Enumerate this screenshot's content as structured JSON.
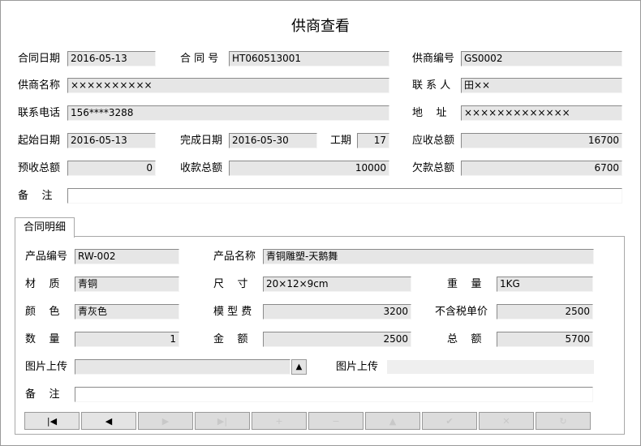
{
  "window": {
    "title": "供商查看"
  },
  "header_form": {
    "contract_date": {
      "label": "合同日期",
      "value": "2016-05-13"
    },
    "contract_no": {
      "label": "合 同 号",
      "value": "HT060513001"
    },
    "supplier_no": {
      "label": "供商编号",
      "value": "GS0002"
    },
    "supplier_name": {
      "label": "供商名称",
      "value": "××××××××××"
    },
    "contact": {
      "label": "联 系 人",
      "value": "田××"
    },
    "phone": {
      "label": "联系电话",
      "value": "156****3288"
    },
    "address": {
      "label": "地    址",
      "value": "×××××××××××××"
    },
    "start_date": {
      "label": "起始日期",
      "value": "2016-05-13"
    },
    "end_date": {
      "label": "完成日期",
      "value": "2016-05-30"
    },
    "duration": {
      "label": "工期",
      "value": "17"
    },
    "receivable_total": {
      "label": "应收总额",
      "value": "16700"
    },
    "prepaid_total": {
      "label": "预收总额",
      "value": "0"
    },
    "received_total": {
      "label": "收款总额",
      "value": "10000"
    },
    "owed_total": {
      "label": "欠款总额",
      "value": "6700"
    },
    "remark": {
      "label": "备    注",
      "value": ""
    }
  },
  "detail_tab": {
    "label": "合同明细",
    "product_no": {
      "label": "产品编号",
      "value": "RW-002"
    },
    "product_name": {
      "label": "产品名称",
      "value": "青铜雕塑-天鹅舞"
    },
    "material": {
      "label": "材    质",
      "value": "青铜"
    },
    "size": {
      "label": "尺    寸",
      "value": "20×12×9cm"
    },
    "weight": {
      "label": "重    量",
      "value": "1KG"
    },
    "color": {
      "label": "颜    色",
      "value": "青灰色"
    },
    "mold_fee": {
      "label": "模 型 费",
      "value": "3200"
    },
    "unit_price": {
      "label": "不含税单价",
      "value": "2500"
    },
    "quantity": {
      "label": "数    量",
      "value": "1"
    },
    "amount": {
      "label": "金    额",
      "value": "2500"
    },
    "total": {
      "label": "总    额",
      "value": "5700"
    },
    "image_upload_1": {
      "label": "图片上传",
      "value": ""
    },
    "image_upload_2": {
      "label": "图片上传",
      "value": ""
    },
    "remark": {
      "label": "备    注",
      "value": ""
    }
  },
  "navigator": {
    "buttons": [
      {
        "icon": "first-record-icon",
        "glyph": "|◀",
        "enabled": true
      },
      {
        "icon": "prior-record-icon",
        "glyph": "◀",
        "enabled": true
      },
      {
        "icon": "next-record-icon",
        "glyph": "▶",
        "enabled": false
      },
      {
        "icon": "last-record-icon",
        "glyph": "▶|",
        "enabled": false
      },
      {
        "icon": "insert-icon",
        "glyph": "+",
        "enabled": false
      },
      {
        "icon": "delete-icon",
        "glyph": "−",
        "enabled": false
      },
      {
        "icon": "edit-icon",
        "glyph": "▲",
        "enabled": false
      },
      {
        "icon": "post-icon",
        "glyph": "✔",
        "enabled": false
      },
      {
        "icon": "cancel-icon",
        "glyph": "✕",
        "enabled": false
      },
      {
        "icon": "refresh-icon",
        "glyph": "↻",
        "enabled": false
      }
    ]
  }
}
